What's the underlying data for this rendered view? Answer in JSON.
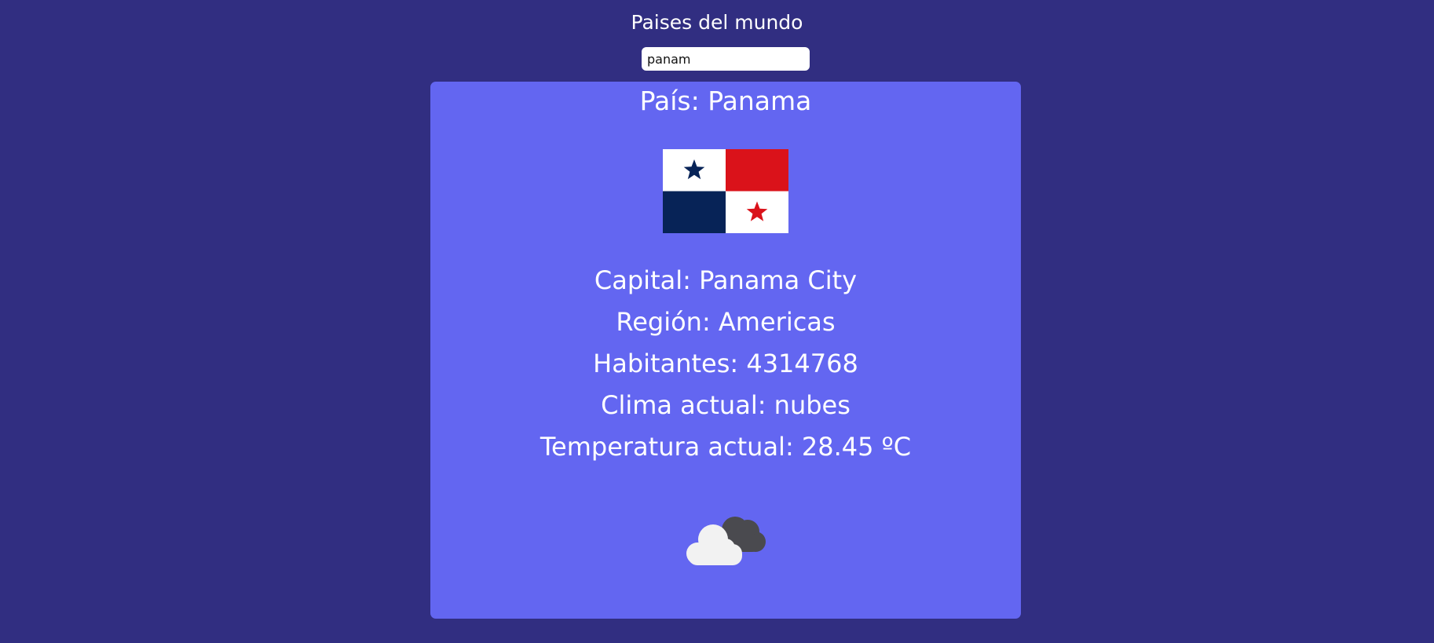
{
  "header": {
    "title": "Paises del mundo"
  },
  "search": {
    "value": "panam",
    "placeholder": ""
  },
  "country": {
    "title": "País: Panama",
    "capital": "Capital: Panama City",
    "region": "Región: Americas",
    "population": "Habitantes: 4314768",
    "weather": "Clima actual: nubes",
    "temperature": "Temperatura actual: 28.45 ºC"
  },
  "icons": {
    "flag": "panama-flag-icon",
    "weather": "cloud-icon"
  },
  "colors": {
    "background": "#312e81",
    "card": "#6366f1",
    "flag_red": "#da121a",
    "flag_blue": "#072357",
    "flag_white": "#ffffff"
  }
}
